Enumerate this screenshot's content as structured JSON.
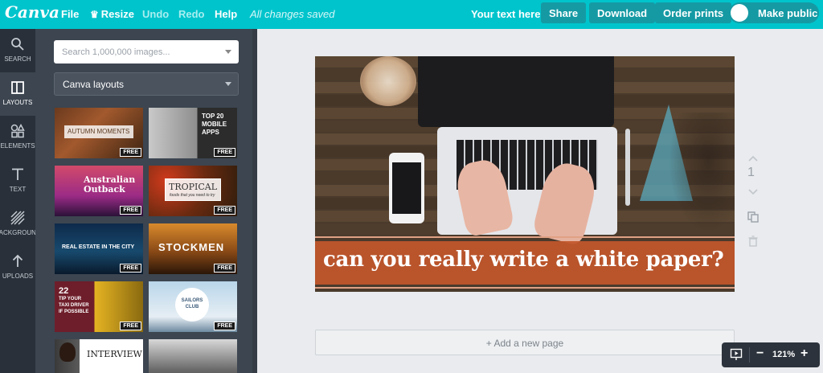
{
  "app": {
    "logo": "Canva"
  },
  "topbar": {
    "file": "File",
    "resize": "Resize",
    "undo": "Undo",
    "redo": "Redo",
    "help": "Help",
    "status": "All changes saved",
    "doc_title": "Your text here",
    "share": "Share",
    "download": "Download",
    "order_prints": "Order prints",
    "make_public": "Make public"
  },
  "rail": {
    "items": [
      {
        "label": "SEARCH",
        "icon": "search-icon"
      },
      {
        "label": "LAYOUTS",
        "icon": "layouts-icon"
      },
      {
        "label": "ELEMENTS",
        "icon": "elements-icon"
      },
      {
        "label": "TEXT",
        "icon": "text-icon"
      },
      {
        "label": "BACKGROUND",
        "icon": "background-icon"
      },
      {
        "label": "UPLOADS",
        "icon": "uploads-icon"
      }
    ]
  },
  "panel": {
    "search_placeholder": "Search 1,000,000 images...",
    "category": "Canva layouts",
    "badge": "FREE",
    "layouts": [
      {
        "title": "AUTUMN MOMENTS"
      },
      {
        "title_lines": [
          "TOP 20",
          "MOBILE",
          "APPS"
        ]
      },
      {
        "title_lines": [
          "Australian",
          "Outback"
        ]
      },
      {
        "title": "TROPICAL",
        "sub": "foods that you need to try"
      },
      {
        "title": "REAL ESTATE IN THE CITY"
      },
      {
        "title": "STOCKMEN"
      },
      {
        "title_lines": [
          "22",
          "TIP YOUR",
          "TAXI DRIVER",
          "IF POSSIBLE"
        ]
      },
      {
        "title_lines": [
          "SAILORS",
          "CLUB"
        ]
      },
      {
        "title": "INTERVIEW"
      },
      {
        "title": ""
      }
    ]
  },
  "canvas": {
    "headline": "can you really write a white paper?",
    "page_number": "1",
    "add_page": "+ Add a new page"
  },
  "zoom": {
    "value": "121%"
  },
  "colors": {
    "accent": "#00c4cc",
    "rail": "#293039",
    "panel": "#3c4550",
    "banner": "#c2562b"
  }
}
